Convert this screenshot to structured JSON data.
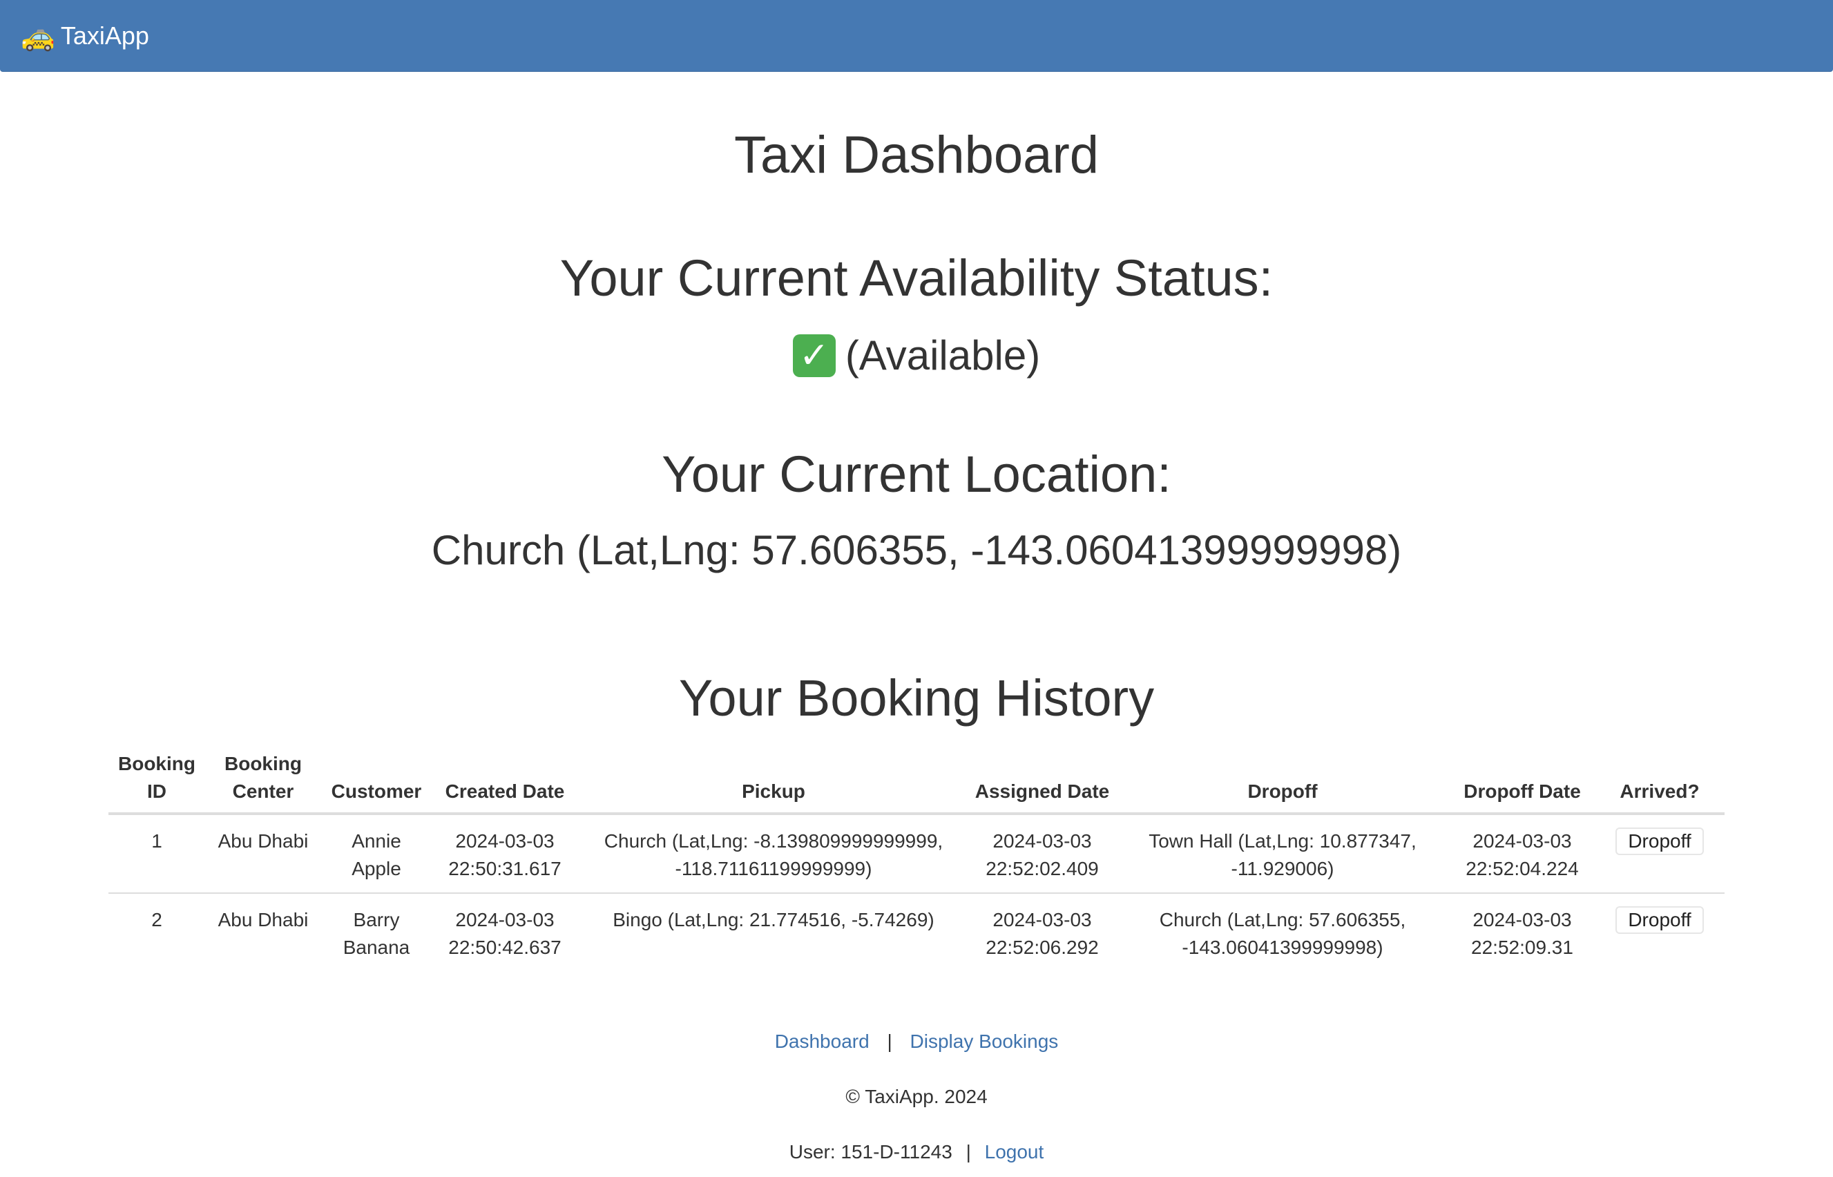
{
  "navbar": {
    "brand_icon": "🚕",
    "brand_label": "TaxiApp",
    "background": "#4679b3"
  },
  "main": {
    "title": "Taxi Dashboard",
    "status_heading": "Your Current Availability Status:",
    "status_icon": "check-mark-button-icon",
    "status_text": "(Available)",
    "location_heading": "Your Current Location:",
    "location_text": "Church (Lat,Lng: 57.606355, -143.06041399999998)",
    "history_heading": "Your Booking History"
  },
  "table": {
    "headers": [
      "Booking ID",
      "Booking Center",
      "Customer",
      "Created Date",
      "Pickup",
      "Assigned Date",
      "Dropoff",
      "Dropoff Date",
      "Arrived?"
    ],
    "rows": [
      {
        "booking_id": "1",
        "booking_center": "Abu Dhabi",
        "customer": "Annie Apple",
        "created_date": "2024-03-03 22:50:31.617",
        "pickup": "Church (Lat,Lng: -8.139809999999999, -118.71161199999999)",
        "assigned_date": "2024-03-03 22:52:02.409",
        "dropoff": "Town Hall (Lat,Lng: 10.877347, -11.929006)",
        "dropoff_date": "2024-03-03 22:52:04.224",
        "action_label": "Dropoff"
      },
      {
        "booking_id": "2",
        "booking_center": "Abu Dhabi",
        "customer": "Barry Banana",
        "created_date": "2024-03-03 22:50:42.637",
        "pickup": "Bingo (Lat,Lng: 21.774516, -5.74269)",
        "assigned_date": "2024-03-03 22:52:06.292",
        "dropoff": "Church (Lat,Lng: 57.606355, -143.06041399999998)",
        "dropoff_date": "2024-03-03 22:52:09.31",
        "action_label": "Dropoff"
      }
    ]
  },
  "footer": {
    "dashboard_link": "Dashboard",
    "separator": "|",
    "display_bookings_link": "Display Bookings",
    "copyright": "© TaxiApp. 2024",
    "user_text": "User: 151-D-11243",
    "logout_link": "Logout",
    "link_color": "#3f73ad"
  }
}
